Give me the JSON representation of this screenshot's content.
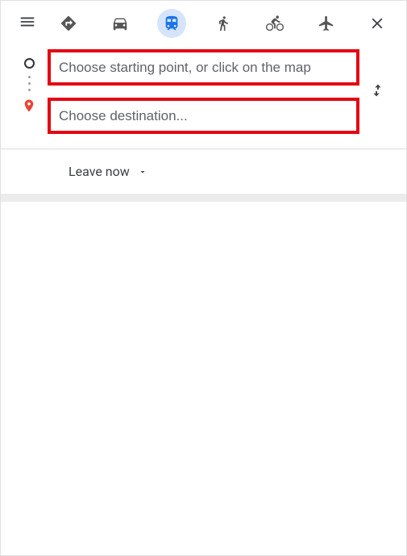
{
  "modes": {
    "best": "Best travel modes",
    "driving": "Driving",
    "transit": "Transit",
    "walking": "Walking",
    "cycling": "Cycling",
    "flights": "Flights",
    "selected": "transit"
  },
  "inputs": {
    "start_placeholder": "Choose starting point, or click on the map",
    "start_value": "",
    "destination_placeholder": "Choose destination...",
    "destination_value": ""
  },
  "actions": {
    "menu": "Menu",
    "close": "Close directions",
    "swap": "Reverse starting point and destination"
  },
  "schedule": {
    "label": "Leave now"
  }
}
